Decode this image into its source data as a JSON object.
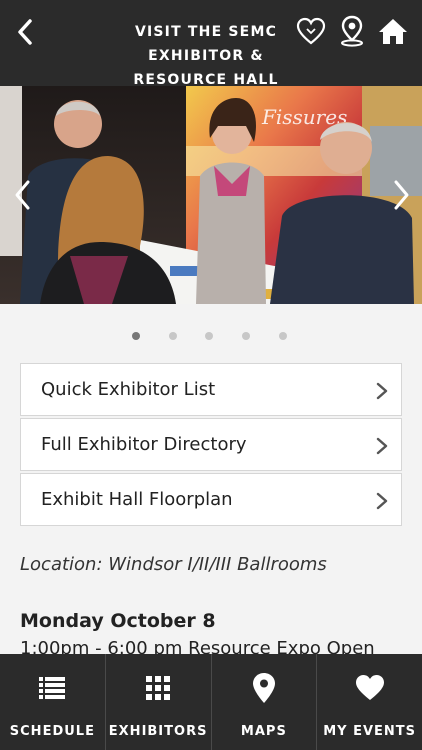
{
  "header": {
    "title_line1": "VISIT THE SEMC EXHIBITOR &",
    "title_line2": "RESOURCE HALL"
  },
  "carousel": {
    "page_count": 5,
    "active_index": 0,
    "banner_text": "Fissures"
  },
  "menu": {
    "items": [
      {
        "label": "Quick Exhibitor List"
      },
      {
        "label": "Full Exhibitor Directory"
      },
      {
        "label": "Exhibit Hall Floorplan"
      }
    ]
  },
  "info": {
    "location": "Location: Windsor I/II/III Ballrooms",
    "day": "Monday October 8",
    "time": "1:00pm - 6:00 pm Resource Expo Open"
  },
  "tabbar": {
    "tabs": [
      {
        "label": "SCHEDULE",
        "icon": "list-icon"
      },
      {
        "label": "EXHIBITORS",
        "icon": "grid-icon"
      },
      {
        "label": "MAPS",
        "icon": "map-pin-icon"
      },
      {
        "label": "MY EVENTS",
        "icon": "heart-icon"
      }
    ]
  },
  "colors": {
    "bar_bg": "#2b2b2b",
    "page_bg": "#f3f3f3",
    "dot_active": "#777777",
    "dot_inactive": "#c7c7c7"
  }
}
